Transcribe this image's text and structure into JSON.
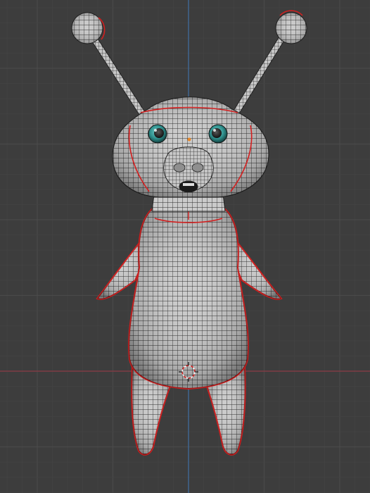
{
  "viewport": {
    "background": "#3d3d3d",
    "grid_major_color": "#4a4a4a",
    "grid_minor_color": "#434343",
    "axis_x_color": "#8a3b44",
    "axis_z_color": "#3f6ea3",
    "seam_color": "#d31f1f",
    "mesh_fill": "#c9c9c9",
    "mesh_wire": "#222222",
    "eye_color": "#2f8f8c"
  },
  "scene": {
    "object": "character-mesh",
    "icons": [
      "3d-cursor-icon",
      "origin-point-icon"
    ]
  }
}
